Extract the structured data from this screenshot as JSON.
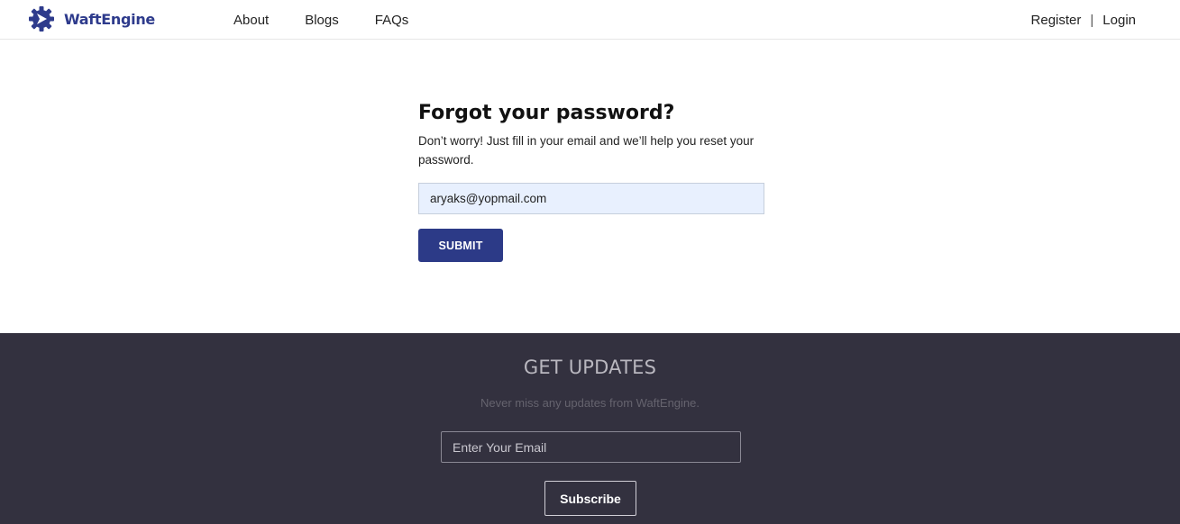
{
  "header": {
    "brand_name": "WaftEngine",
    "brand_color": "#2e3b8c",
    "logo_icon": "gear-logo-icon",
    "nav": [
      {
        "label": "About"
      },
      {
        "label": "Blogs"
      },
      {
        "label": "FAQs"
      }
    ],
    "register_label": "Register",
    "separator": "|",
    "login_label": "Login"
  },
  "form": {
    "title": "Forgot your password?",
    "description": "Don’t worry! Just fill in your email and we’ll help you reset your password.",
    "email_value": "aryaks@yopmail.com",
    "submit_label": "SUBMIT",
    "submit_color": "#2c3a87",
    "input_background": "#e8f0fe"
  },
  "updates": {
    "title": "GET UPDATES",
    "subtitle": "Never miss any updates from WaftEngine.",
    "email_placeholder": "Enter Your Email",
    "subscribe_label": "Subscribe",
    "background": "#33313f"
  }
}
